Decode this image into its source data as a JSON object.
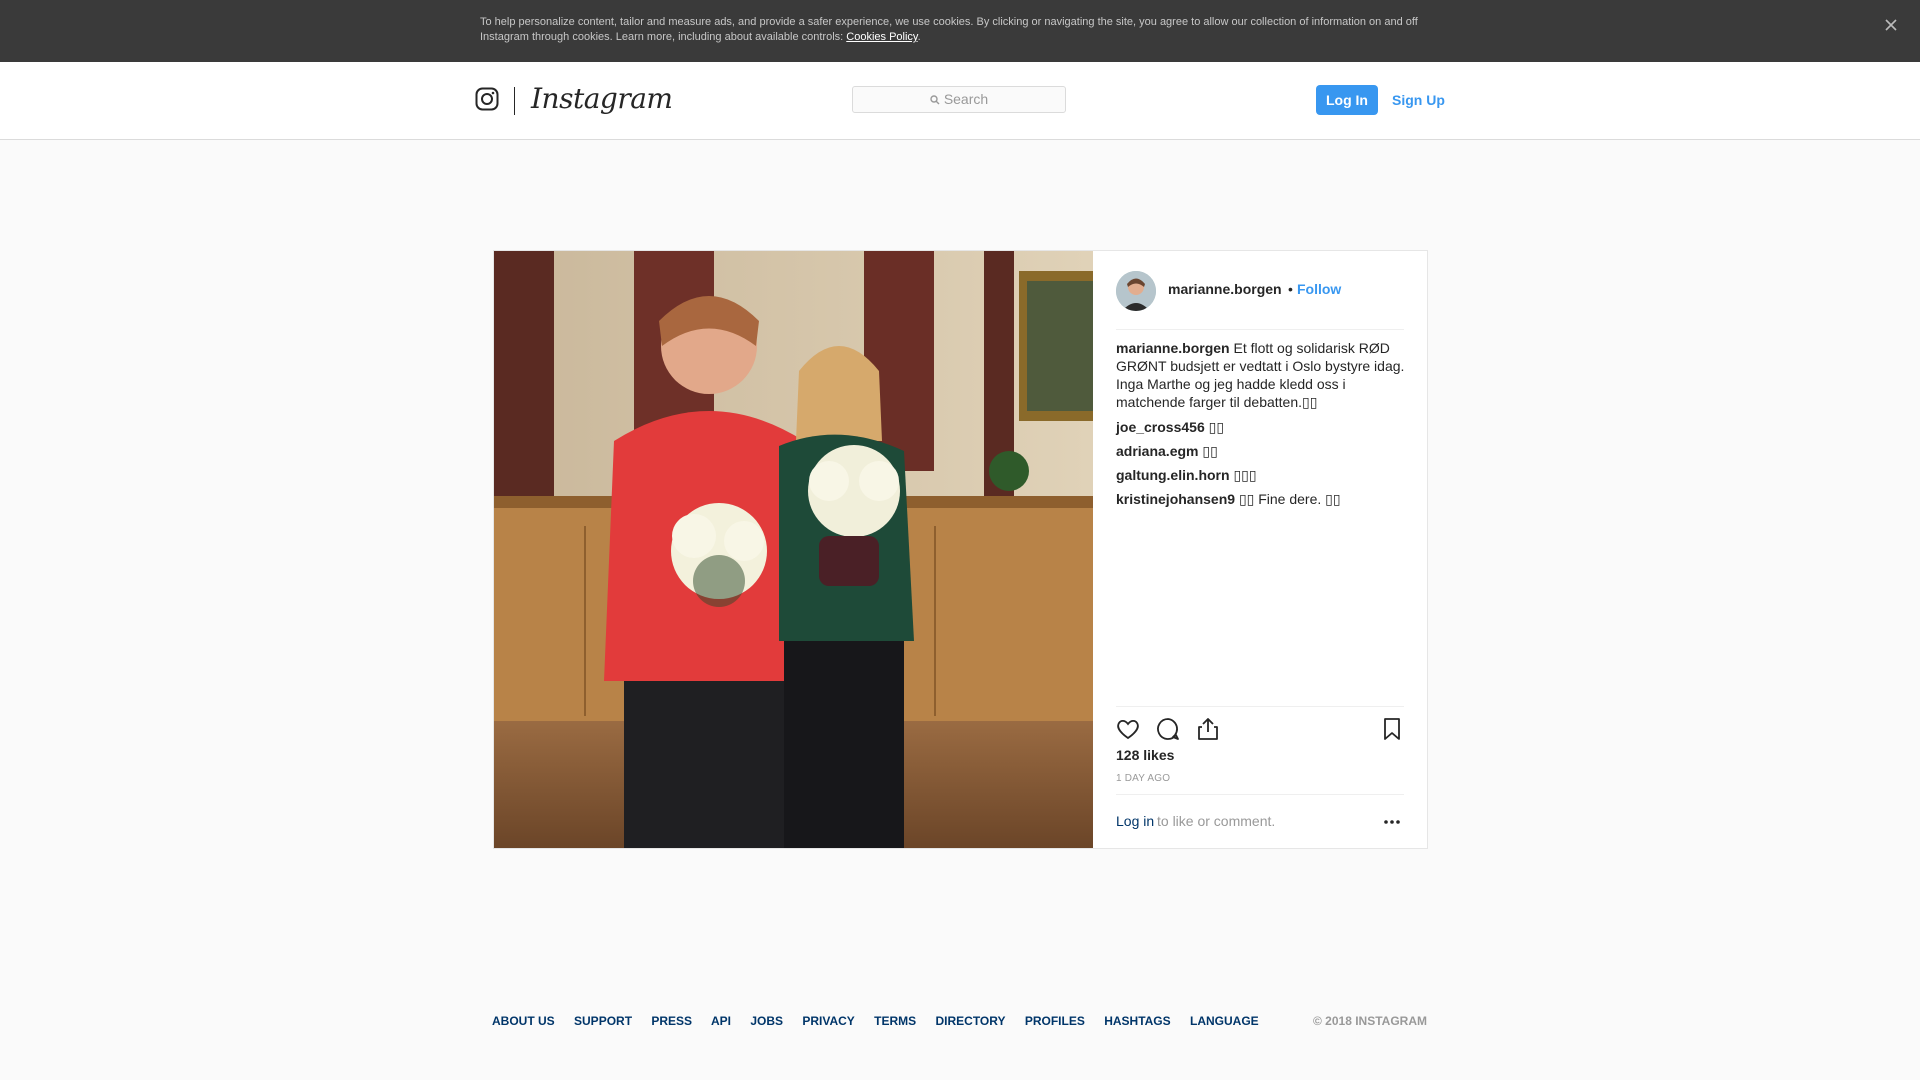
{
  "cookie_banner": {
    "text": "To help personalize content, tailor and measure ads, and provide a safer experience, we use cookies. By clicking or navigating the site, you agree to allow our collection of information on and off Instagram through cookies. Learn more, including about available controls: ",
    "link": "Cookies Policy",
    "link_suffix": ".",
    "close_icon": "close-icon"
  },
  "header": {
    "logo_text": "Instagram",
    "search_placeholder": "Search",
    "login_label": "Log In",
    "signup_label": "Sign Up"
  },
  "post": {
    "username": "marianne.borgen",
    "dot": "•",
    "follow_label": "Follow",
    "caption_user": "marianne.borgen",
    "caption_text": "Et flott og solidarisk RØD GRØNT budsjett er vedtatt i Oslo bystyre idag. Inga Marthe og jeg hadde kledd oss i matchende farger til debatten.▯▯",
    "comments": [
      {
        "user": "joe_cross456",
        "text": "▯▯"
      },
      {
        "user": "adriana.egm",
        "text": "▯▯"
      },
      {
        "user": "galtung.elin.horn",
        "text": "▯▯▯"
      },
      {
        "user": "kristinejohansen9",
        "text": "▯▯  Fine dere. ▯▯"
      }
    ],
    "likes": "128 likes",
    "time_ago": "1 DAY AGO",
    "login_link": "Log in",
    "login_rest": "to like or comment.",
    "icons": [
      "heart-icon",
      "comment-icon",
      "share-icon",
      "bookmark-icon",
      "more-icon"
    ]
  },
  "footer": {
    "links": [
      "ABOUT US",
      "SUPPORT",
      "PRESS",
      "API",
      "JOBS",
      "PRIVACY",
      "TERMS",
      "DIRECTORY",
      "PROFILES",
      "HASHTAGS",
      "LANGUAGE"
    ],
    "copyright": "© 2018 INSTAGRAM"
  },
  "colors": {
    "accent": "#3897f0",
    "link_dark": "#003569",
    "cookie_bg": "#3a3a3a"
  }
}
